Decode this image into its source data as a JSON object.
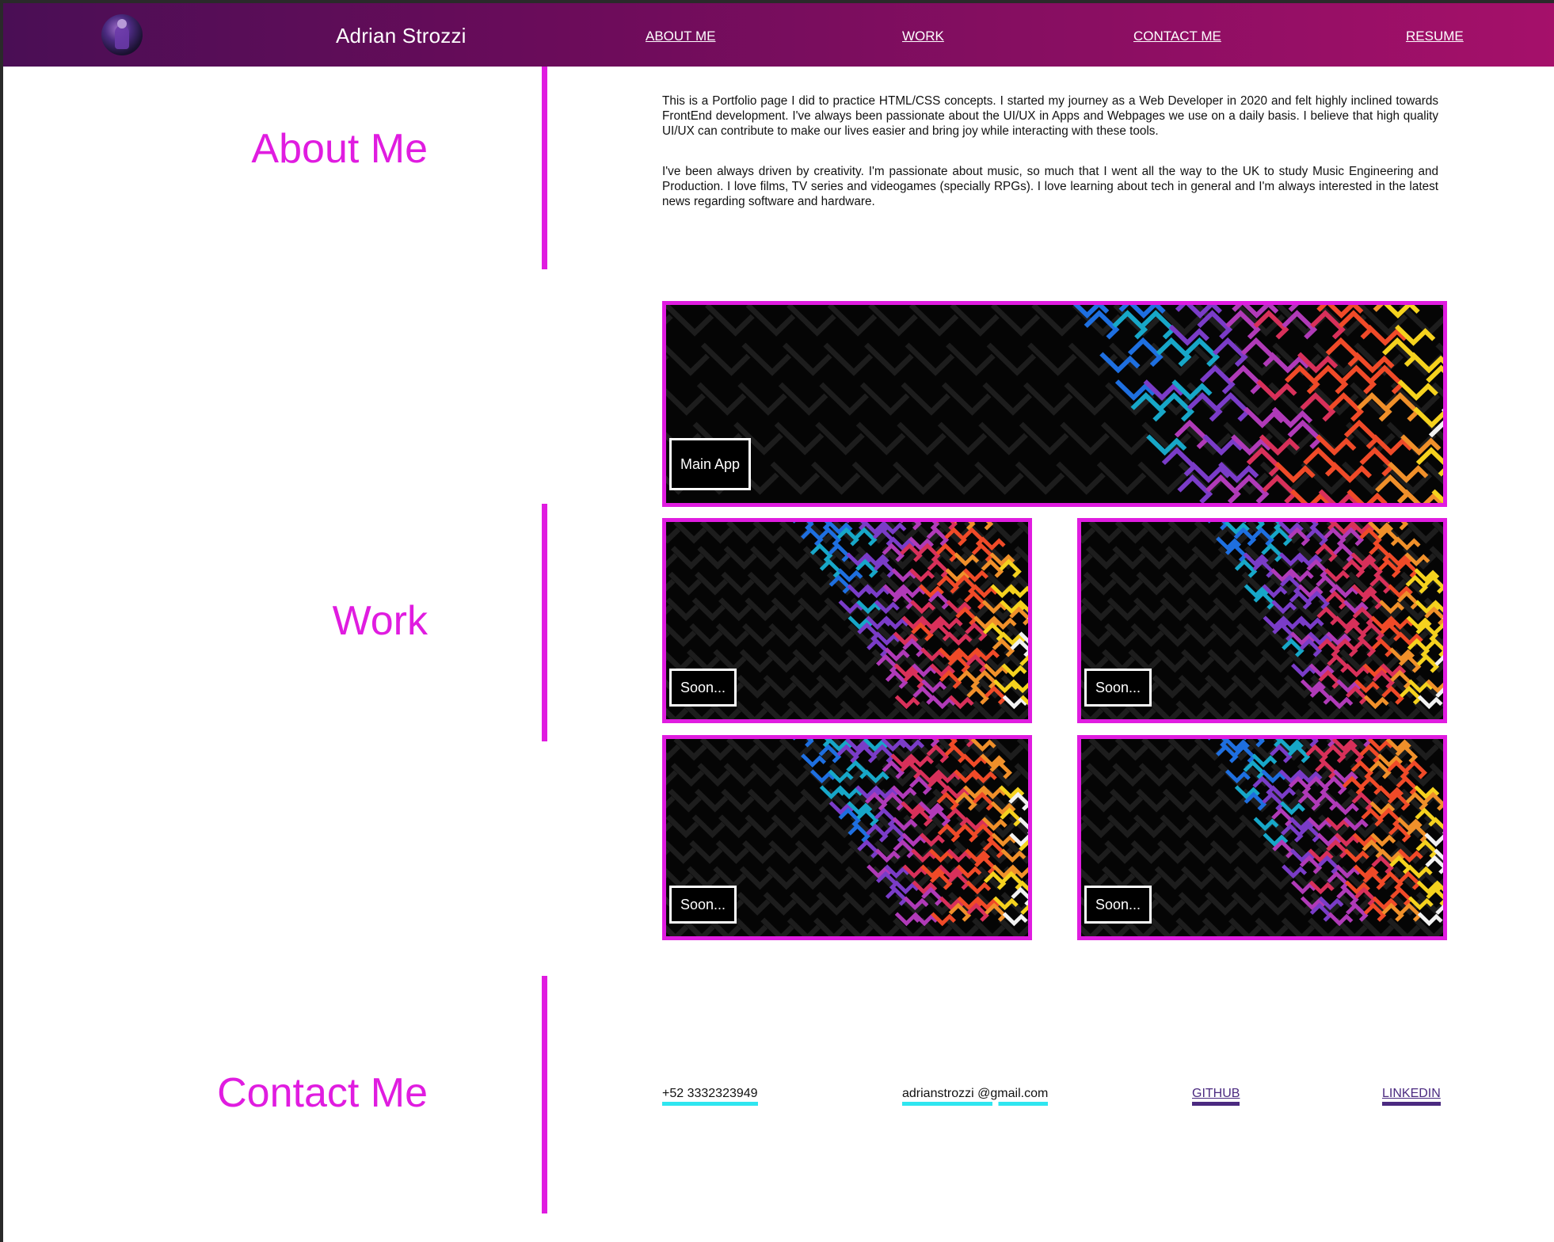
{
  "header": {
    "brand": "Adrian Strozzi",
    "nav": [
      {
        "label": "ABOUT ME"
      },
      {
        "label": "WORK"
      },
      {
        "label": "CONTACT ME"
      },
      {
        "label": "RESUME"
      }
    ]
  },
  "about": {
    "title": "About Me",
    "paragraphs": [
      "This is a Portfolio page I did to practice HTML/CSS concepts. I started my journey as a Web Developer in 2020 and felt highly inclined towards FrontEnd development. I've always been passionate about the UI/UX in Apps and Webpages we use on a daily basis. I believe that high quality UI/UX can contribute to make our lives easier and bring joy while interacting with these tools.",
      "I've been always driven by creativity. I'm passionate about music, so much that I went all the way to the UK to study Music Engineering and Production. I love films, TV series and videogames (specially RPGs). I love learning about tech in general and I'm always interested in the latest news regarding software and hardware."
    ]
  },
  "work": {
    "title": "Work",
    "main_label": "Main App",
    "items": [
      {
        "label": "Soon..."
      },
      {
        "label": "Soon..."
      },
      {
        "label": "Soon..."
      },
      {
        "label": "Soon..."
      }
    ]
  },
  "contact": {
    "title": "Contact Me",
    "phone": "+52 3332323949",
    "email": "adrianstrozzi @gmail.com",
    "github": "GITHUB",
    "linkedin": "LINKEDIN"
  },
  "colors": {
    "accent": "#e01ce0",
    "header_start": "#4a0e55",
    "header_end": "#a5106a",
    "contact_underline": "#2ee6f0",
    "social_link": "#4b2a80"
  }
}
